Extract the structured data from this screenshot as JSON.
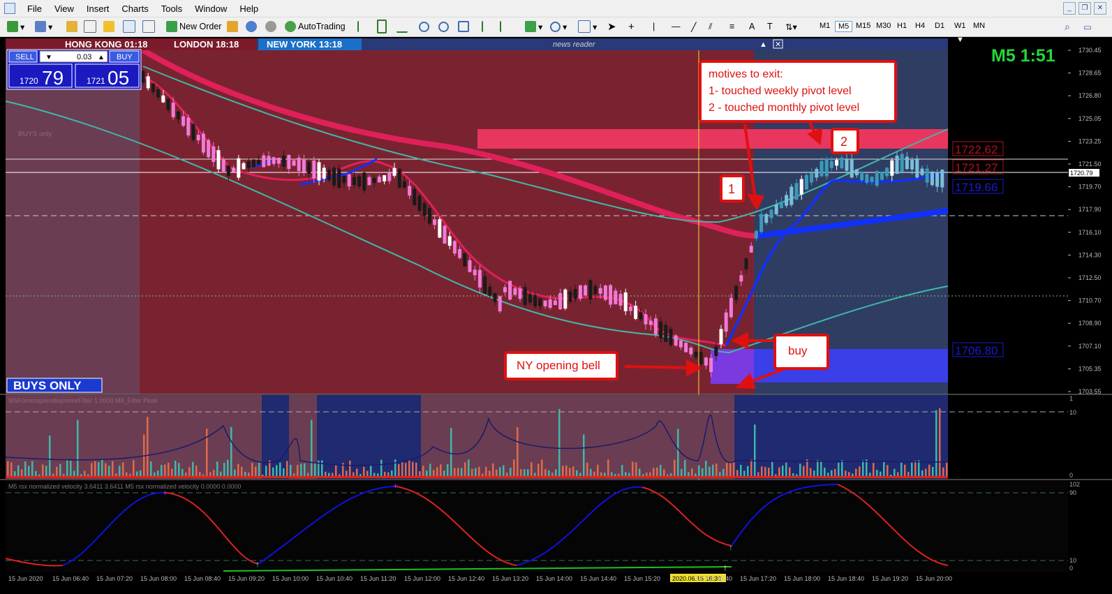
{
  "menu": {
    "items": [
      "File",
      "View",
      "Insert",
      "Charts",
      "Tools",
      "Window",
      "Help"
    ]
  },
  "toolbar": {
    "new_order": "New Order",
    "autotrading": "AutoTrading",
    "timeframes": [
      "M1",
      "M5",
      "M15",
      "M30",
      "H1",
      "H4",
      "D1",
      "W1",
      "MN"
    ],
    "active_timeframe": "M5"
  },
  "sessions": {
    "hong_kong": "HONG KONG  01:18",
    "london": "LONDON  18:18",
    "new_york": "NEW YORK  13:18",
    "news_reader": "news reader"
  },
  "trade_panel": {
    "sell_label": "SELL",
    "buy_label": "BUY",
    "lot": "0.03",
    "sell_small": "1720",
    "sell_big": "79",
    "buy_small": "1721",
    "buy_big": "05"
  },
  "timer": "M5 1:51",
  "labels": {
    "buys_only_small": "BUYS only",
    "buys_only_banner": "BUYS ONLY",
    "indicator1": "MSFomesapiendiupremeFilter 1.0000  M8_Filter  Peak",
    "indicator2": "M5 rsx normalized velocity 3.6411 3.6411  M5 rsx normalized velocity 0.0000 0.0000"
  },
  "annotations": {
    "exit_lines": [
      "motives to exit:",
      "1- touched weekly pivot level",
      "2 - touched monthly pivot level"
    ],
    "marker1": "1",
    "marker2": "2",
    "ny_bell": "NY opening bell",
    "buy": "buy"
  },
  "levels": {
    "weekly_r": "1722.62",
    "weekly_r2": "1721.27",
    "pivot": "1719.66",
    "support": "1706.80",
    "current": "1720.79"
  },
  "price_axis": [
    "1730.45",
    "1728.65",
    "1726.80",
    "1725.05",
    "1723.25",
    "1721.50",
    "1719.70",
    "1717.90",
    "1716.10",
    "1714.30",
    "1712.50",
    "1710.70",
    "1708.90",
    "1707.10",
    "1705.35",
    "1703.55"
  ],
  "sub1_axis": [
    "1",
    "10",
    "0"
  ],
  "sub2_axis": [
    "102",
    "90",
    "10",
    "0"
  ],
  "time_axis": [
    "15 Jun 2020",
    "15 Jun 06:40",
    "15 Jun 07:20",
    "15 Jun 08:00",
    "15 Jun 08:40",
    "15 Jun 09:20",
    "15 Jun 10:00",
    "15 Jun 10:40",
    "15 Jun 11:20",
    "15 Jun 12:00",
    "15 Jun 12:40",
    "15 Jun 13:20",
    "15 Jun 14:00",
    "15 Jun 14:40",
    "15 Jun 15:20",
    "2020.06.15 16:30",
    "15 Jun 16:40",
    "15 Jun 17:20",
    "15 Jun 18:00",
    "15 Jun 18:40",
    "15 Jun 19:20",
    "15 Jun 20:00"
  ],
  "cursor_time": "2020.06.15 16:30",
  "colors": {
    "bg_bear_zone": "#6b3d52",
    "bg_dark_red": "#7a2330",
    "bg_bull_zone": "#2f3d63",
    "pivot_band": "#e8365e",
    "support_band": "#3b3fe8",
    "ma_red": "#e0205a",
    "ma_blue": "#1030ff",
    "ma_teal": "#3fb8a8",
    "callout_border": "#e01010"
  }
}
